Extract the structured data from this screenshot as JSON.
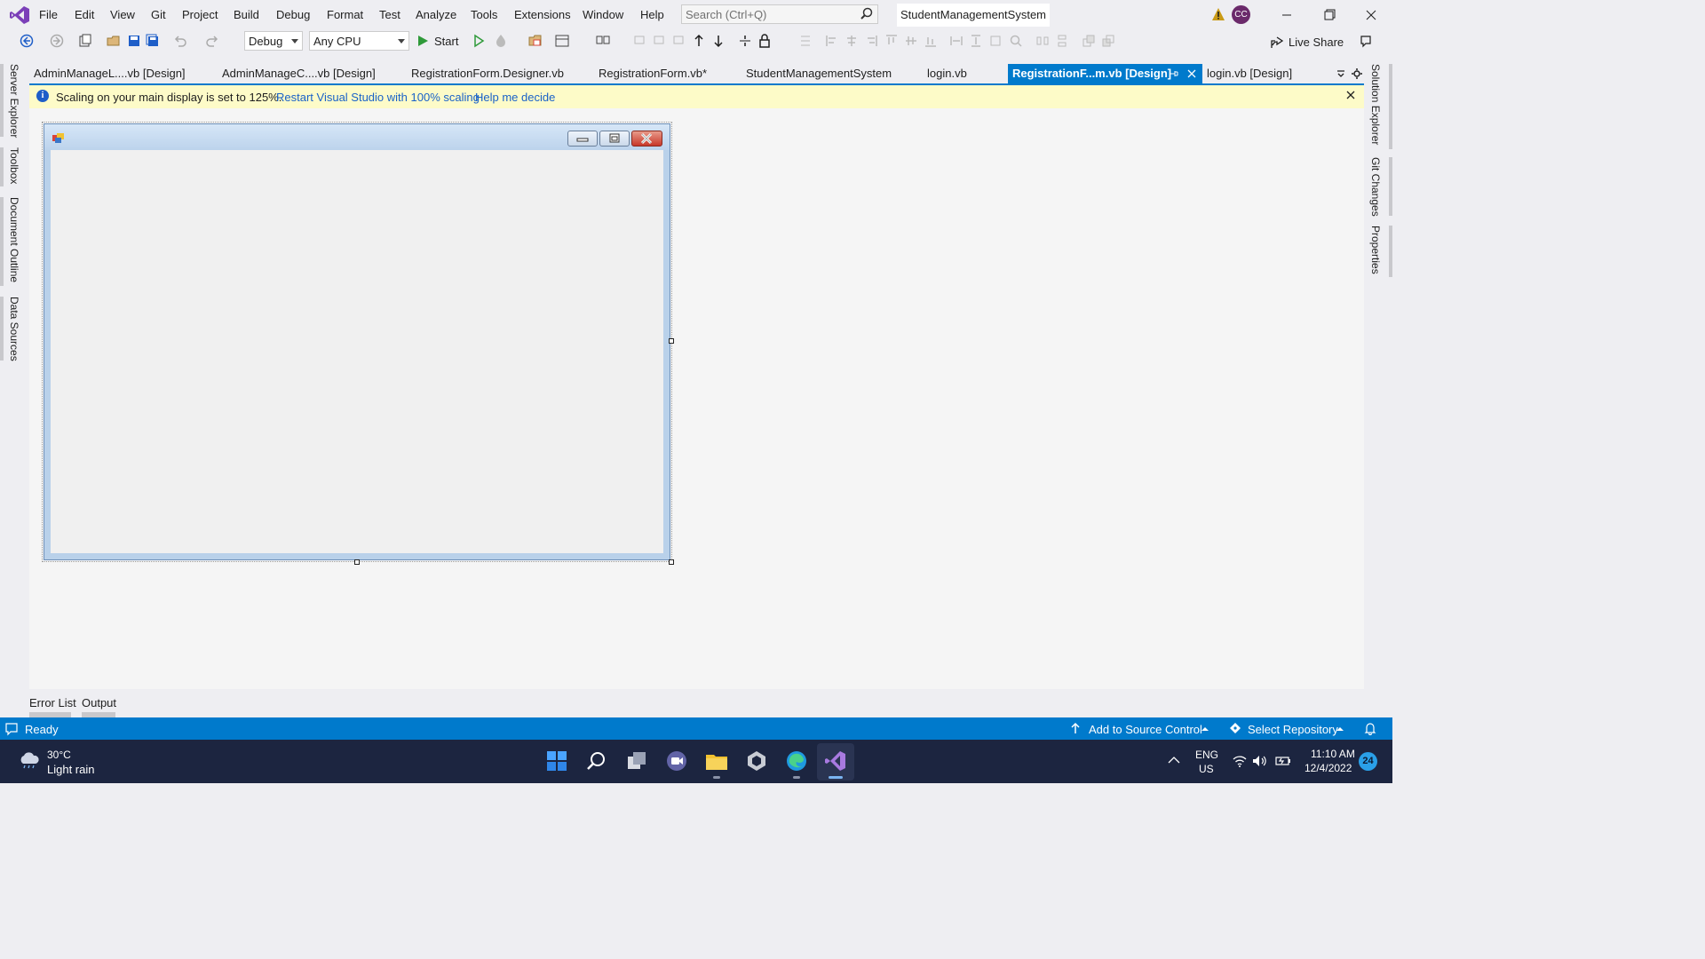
{
  "menu": {
    "items": [
      "File",
      "Edit",
      "View",
      "Git",
      "Project",
      "Build",
      "Debug",
      "Format",
      "Test",
      "Analyze",
      "Tools",
      "Extensions",
      "Window",
      "Help"
    ],
    "search_placeholder": "Search (Ctrl+Q)",
    "solution_name": "StudentManagementSystem",
    "avatar_initials": "CC"
  },
  "toolbar": {
    "config": "Debug",
    "platform": "Any CPU",
    "start_label": "Start",
    "live_share": "Live Share"
  },
  "tabs": [
    {
      "label": "AdminManageL....vb [Design]"
    },
    {
      "label": "AdminManageC....vb [Design]"
    },
    {
      "label": "RegistrationForm.Designer.vb"
    },
    {
      "label": "RegistrationForm.vb*"
    },
    {
      "label": "StudentManagementSystem"
    },
    {
      "label": "login.vb"
    },
    {
      "label": "RegistrationF...m.vb [Design]",
      "active": true
    },
    {
      "label": "login.vb [Design]"
    }
  ],
  "infobar": {
    "message": "Scaling on your main display is set to 125%.",
    "link_restart": "Restart Visual Studio with 100% scaling",
    "link_help": "Help me decide"
  },
  "left_panels": [
    "Server Explorer",
    "Toolbox",
    "Document Outline",
    "Data Sources"
  ],
  "right_panels": [
    "Solution Explorer",
    "Git Changes",
    "Properties"
  ],
  "bottom_tabs": [
    "Error List",
    "Output"
  ],
  "status": {
    "ready": "Ready",
    "source_control": "Add to Source Control",
    "repository": "Select Repository"
  },
  "taskbar": {
    "weather_temp": "30°C",
    "weather_desc": "Light rain",
    "lang_top": "ENG",
    "lang_bottom": "US",
    "time": "11:10 AM",
    "date": "12/4/2022",
    "notification_count": "24"
  },
  "colors": {
    "accent": "#007acc",
    "infobar_bg": "#fdfbc8",
    "taskbar_bg": "#1c2540",
    "close_red": "#d9443a"
  }
}
